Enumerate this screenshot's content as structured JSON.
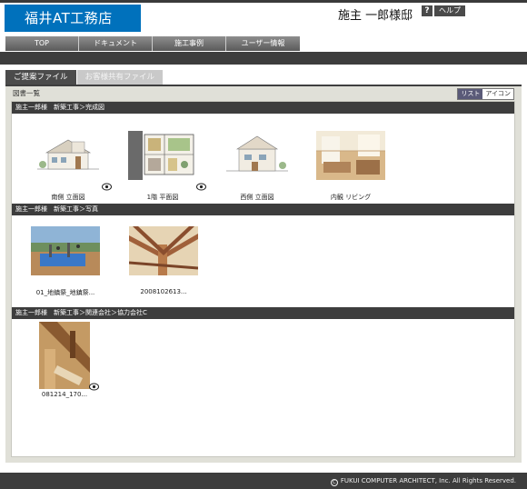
{
  "header": {
    "logo": "福井AT工務店",
    "owner_name": "施主 一郎様邸",
    "help_icon": "?",
    "help_label": "ヘルプ"
  },
  "nav": {
    "items": [
      "TOP",
      "ドキュメント",
      "施工事例",
      "ユーザー情報"
    ]
  },
  "tabs": {
    "active": "ご提案ファイル",
    "inactive": "お客様共有ファイル"
  },
  "panel": {
    "title": "図書一覧",
    "view_list": "リスト",
    "view_icon": "アイコン"
  },
  "sections": [
    {
      "header": "施主一郎様　新築工事＞完成図",
      "items": [
        {
          "caption": "南側 立面図",
          "icon": "elevation-drawing-icon"
        },
        {
          "caption": "1階 平面図",
          "icon": "floor-plan-icon"
        },
        {
          "caption": "西側 立面図",
          "icon": "elevation-drawing-icon"
        },
        {
          "caption": "内観 リビング",
          "icon": "interior-photo-icon"
        }
      ]
    },
    {
      "header": "施主一郎様　新築工事＞写真",
      "items": [
        {
          "caption": "01_地鎮祭_地鎮祭...",
          "icon": "site-photo-icon"
        },
        {
          "caption": "2008102613...",
          "icon": "framing-photo-icon"
        }
      ]
    },
    {
      "header": "施主一郎様　新築工事＞関連会社＞協力会社C",
      "items": [
        {
          "caption": "081214_170...",
          "icon": "timber-photo-icon"
        }
      ]
    }
  ],
  "footer": {
    "copyright": "FUKUI COMPUTER ARCHITECT, Inc. All Rights Reserved."
  }
}
